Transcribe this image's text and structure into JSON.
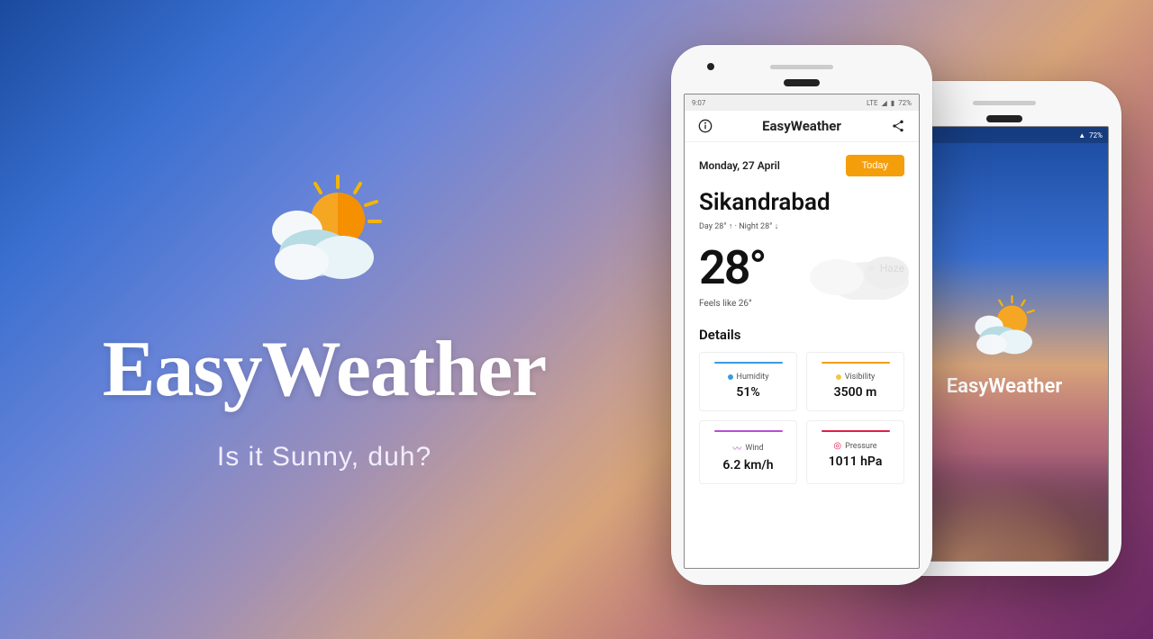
{
  "hero": {
    "title": "EasyWeather",
    "tagline": "Is it Sunny, duh?"
  },
  "splash": {
    "title": "EasyWeather",
    "battery": "72%"
  },
  "statusbar": {
    "time": "9:07",
    "network": "LTE",
    "battery": "72%"
  },
  "app": {
    "header_title": "EasyWeather",
    "date": "Monday, 27 April",
    "today_button": "Today",
    "city": "Sikandrabad",
    "day_night": "Day 28° ↑ · Night 28° ↓",
    "temperature": "28°",
    "condition": "Haze",
    "feels_like": "Feels like 26°",
    "details_title": "Details",
    "details": {
      "humidity": {
        "label": "Humidity",
        "value": "51%",
        "color": "#3b9ae1"
      },
      "visibility": {
        "label": "Visibility",
        "value": "3500 m",
        "color": "#f59e0b"
      },
      "wind": {
        "label": "Wind",
        "value": "6.2 km/h",
        "color": "#b84dd9"
      },
      "pressure": {
        "label": "Pressure",
        "value": "1011 hPa",
        "color": "#e11d48"
      }
    }
  }
}
